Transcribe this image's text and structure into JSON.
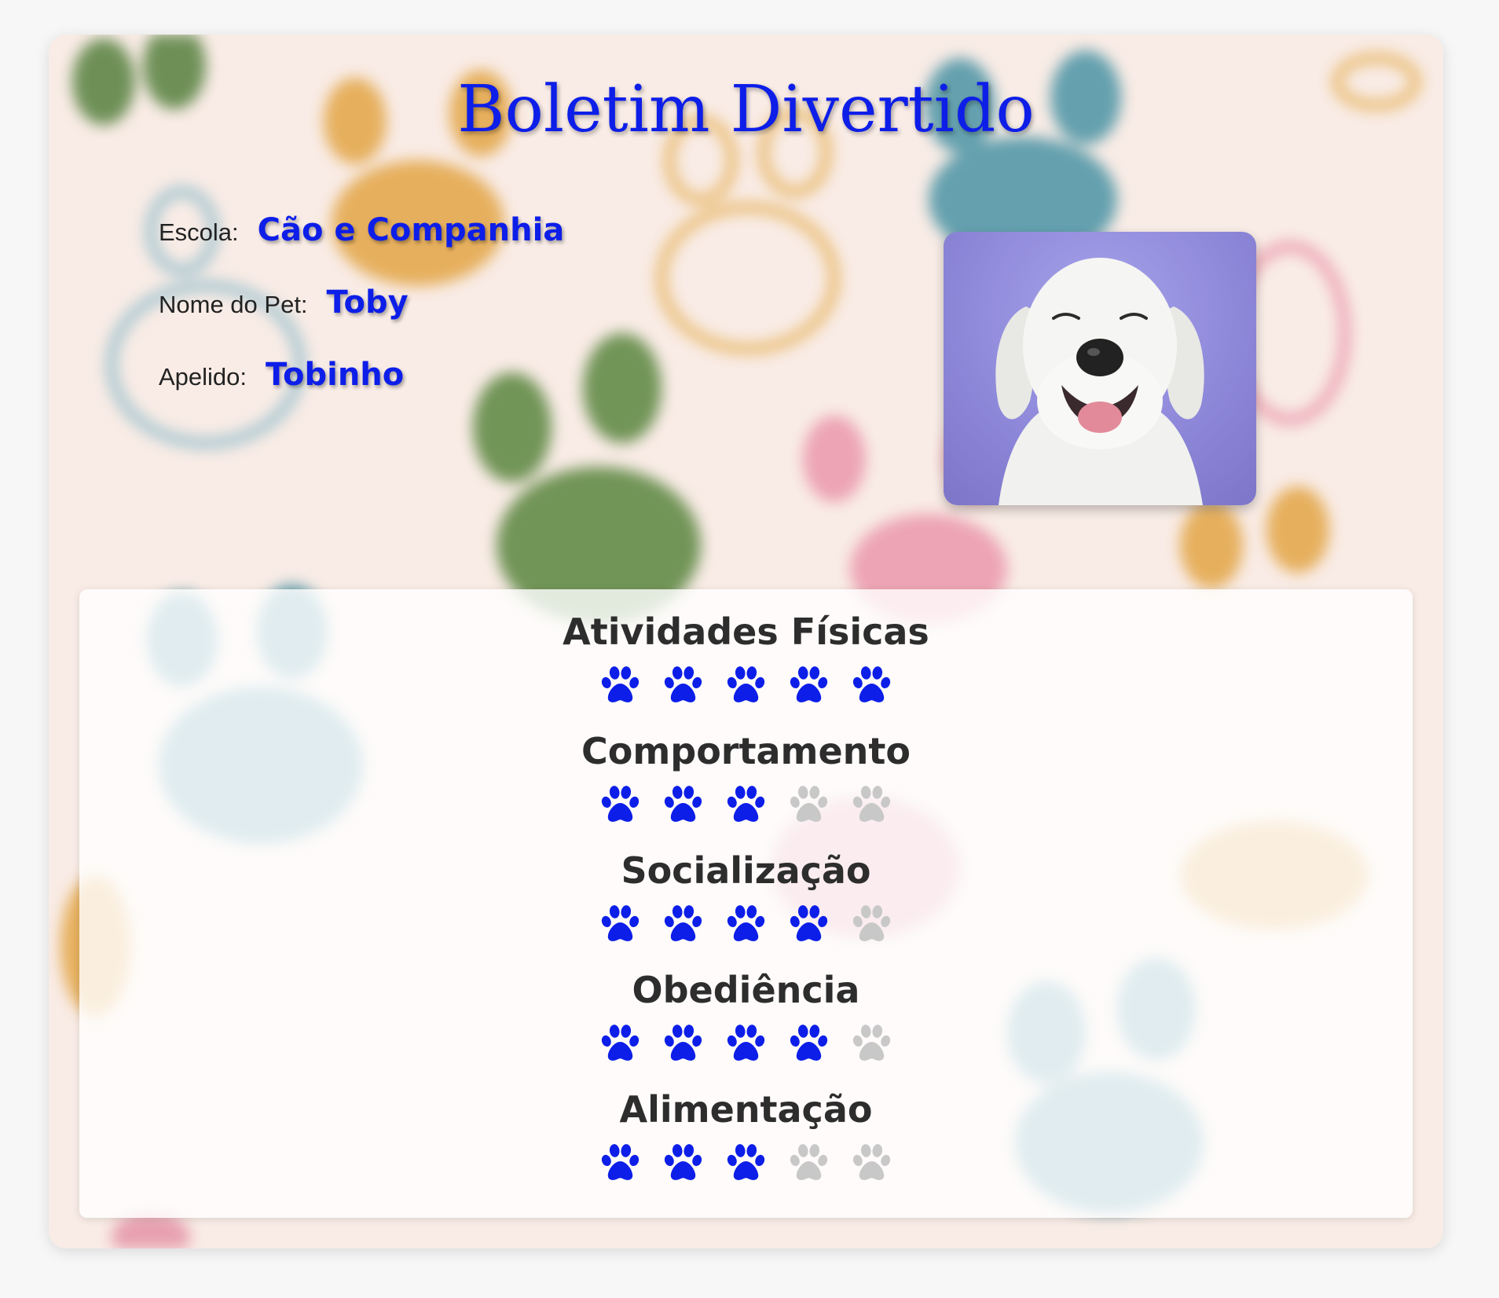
{
  "title": "Boletim Divertido",
  "info": {
    "escola_label": "Escola:",
    "escola_value": "Cão e Companhia",
    "pet_label": "Nome do Pet:",
    "pet_value": "Toby",
    "apelido_label": "Apelido:",
    "apelido_value": "Tobinho"
  },
  "photo": {
    "subject": "smiling white dog on purple background"
  },
  "colors": {
    "accent": "#0d1ee8",
    "inactive_paw": "#c8c8c8",
    "heading": "#2d2d2d"
  },
  "ratings_max": 5,
  "categories": [
    {
      "name": "Atividades Físicas",
      "rating": 5
    },
    {
      "name": "Comportamento",
      "rating": 3
    },
    {
      "name": "Socialização",
      "rating": 4
    },
    {
      "name": "Obediência",
      "rating": 4
    },
    {
      "name": "Alimentação",
      "rating": 3
    }
  ]
}
